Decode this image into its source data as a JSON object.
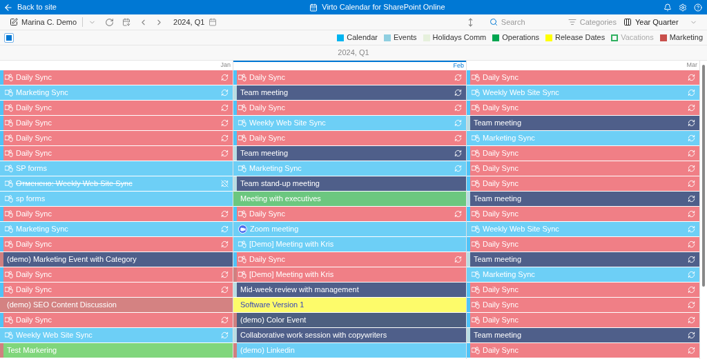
{
  "app_bar": {
    "back_label": "Back to site",
    "title": "Virto Calendar for SharePoint Online"
  },
  "toolbar": {
    "user": "Marina C. Demo",
    "period": "2024, Q1",
    "search": {
      "placeholder": "Search"
    },
    "categories": "Categories",
    "view": "Year Quarter"
  },
  "select_all": {
    "checked": true
  },
  "legend": [
    {
      "label": "Calendar",
      "color": "#00b4f0",
      "checked": true
    },
    {
      "label": "Events",
      "color": "#8fcfe0",
      "checked": true
    },
    {
      "label": "Holidays Comm",
      "color": "#e6f0dc",
      "checked": true
    },
    {
      "label": "Operations",
      "color": "#00a650",
      "checked": true
    },
    {
      "label": "Release Dates",
      "color": "#ffff00",
      "checked": true
    },
    {
      "label": "Vacations",
      "color": "#30b060",
      "checked": false
    },
    {
      "label": "Marketing",
      "color": "#c9504c",
      "checked": true
    }
  ],
  "period_title": "2024, Q1",
  "months": [
    {
      "label": "Jan",
      "current": false,
      "events": [
        {
          "title": "Daily Sync",
          "kind": "teams",
          "recurring": true,
          "canceled": false,
          "color": "#f07f86",
          "category": {
            "color": "#4fc3f7"
          }
        },
        {
          "title": "Marketing Sync",
          "kind": "teams",
          "recurring": true,
          "canceled": false,
          "color": "#6dcff6",
          "category": {
            "color": "#6dcff6"
          }
        },
        {
          "title": "Daily Sync",
          "kind": "teams",
          "recurring": true,
          "canceled": false,
          "color": "#f07f86",
          "category": {
            "color": "#4fc3f7"
          }
        },
        {
          "title": "Daily Sync",
          "kind": "teams",
          "recurring": true,
          "canceled": false,
          "color": "#f07f86",
          "category": {
            "color": "#4fc3f7"
          }
        },
        {
          "title": "Daily Sync",
          "kind": "teams",
          "recurring": true,
          "canceled": false,
          "color": "#f07f86",
          "category": {
            "color": "#4fc3f7"
          }
        },
        {
          "title": "Daily Sync",
          "kind": "teams",
          "recurring": true,
          "canceled": false,
          "color": "#f07f86",
          "category": {
            "color": "#4fc3f7"
          }
        },
        {
          "title": "SP forms",
          "kind": "teams",
          "recurring": false,
          "canceled": false,
          "color": "#6dcff6",
          "category": {
            "color": "#6dcff6"
          }
        },
        {
          "title": "Отменено: Weekly Web Site Sync",
          "kind": "teams",
          "recurring": true,
          "canceled": true,
          "color": "#6dcff6",
          "category": {
            "color": "#6dcff6"
          }
        },
        {
          "title": "sp forms",
          "kind": "teams",
          "recurring": false,
          "canceled": false,
          "color": "#6dcff6",
          "category": {
            "color": "#6dcff6"
          }
        },
        {
          "title": "Daily Sync",
          "kind": "teams",
          "recurring": true,
          "canceled": false,
          "color": "#f07f86",
          "category": {
            "color": "#4fc3f7"
          }
        },
        {
          "title": "Marketing Sync",
          "kind": "teams",
          "recurring": true,
          "canceled": false,
          "color": "#6dcff6",
          "category": {
            "color": "#6dcff6"
          }
        },
        {
          "title": "Daily Sync",
          "kind": "teams",
          "recurring": true,
          "canceled": false,
          "color": "#f07f86",
          "category": {
            "color": "#4fc3f7"
          }
        },
        {
          "title": "(demo) Marketing Event with Category",
          "kind": "plain",
          "recurring": false,
          "canceled": false,
          "color": "#4f5f8a",
          "category": {
            "color": "#d08080"
          }
        },
        {
          "title": "Daily Sync",
          "kind": "teams",
          "recurring": true,
          "canceled": false,
          "color": "#f07f86",
          "category": {
            "color": "#4fc3f7"
          }
        },
        {
          "title": "Daily Sync",
          "kind": "teams",
          "recurring": true,
          "canceled": false,
          "color": "#f07f86",
          "category": {
            "color": "#4fc3f7"
          }
        },
        {
          "title": "(demo) SEO Content Discussion",
          "kind": "plain",
          "recurring": false,
          "canceled": false,
          "color": "#d48282",
          "category": {
            "color": "#d48282"
          }
        },
        {
          "title": "Daily Sync",
          "kind": "teams",
          "recurring": true,
          "canceled": false,
          "color": "#f07f86",
          "category": {
            "color": "#4fc3f7"
          }
        },
        {
          "title": "Weekly Web Site Sync",
          "kind": "teams",
          "recurring": true,
          "canceled": false,
          "color": "#6dcff6",
          "category": {
            "color": "#6dcff6"
          }
        },
        {
          "title": "Test Markering",
          "kind": "plain",
          "recurring": false,
          "canceled": false,
          "color": "#80d67c",
          "category": {
            "color": "#d08080"
          }
        }
      ]
    },
    {
      "label": "Feb",
      "current": true,
      "events": [
        {
          "title": "Daily Sync",
          "kind": "teams",
          "recurring": true,
          "canceled": false,
          "color": "#f07f86",
          "category": {
            "color": "#4fc3f7"
          }
        },
        {
          "title": "Team meeting",
          "kind": "plain",
          "recurring": true,
          "canceled": false,
          "color": "#4f5f8a",
          "category": {
            "color": "#b9dde3"
          }
        },
        {
          "title": "Daily Sync",
          "kind": "teams",
          "recurring": true,
          "canceled": false,
          "color": "#f07f86",
          "category": {
            "color": "#4fc3f7"
          }
        },
        {
          "title": "Weekly Web Site Sync",
          "kind": "teams",
          "recurring": true,
          "canceled": false,
          "color": "#6dcff6",
          "category": {
            "color": "#6dcff6"
          }
        },
        {
          "title": "Daily Sync",
          "kind": "teams",
          "recurring": true,
          "canceled": false,
          "color": "#f07f86",
          "category": {
            "color": "#4fc3f7"
          }
        },
        {
          "title": "Team meeting",
          "kind": "plain",
          "recurring": true,
          "canceled": false,
          "color": "#4f5f8a",
          "category": {
            "color": "#b9dde3"
          }
        },
        {
          "title": "Marketing Sync",
          "kind": "teams",
          "recurring": true,
          "canceled": false,
          "color": "#6dcff6",
          "category": {
            "color": "#6dcff6"
          }
        },
        {
          "title": "Team stand-up meeting",
          "kind": "plain",
          "recurring": false,
          "canceled": false,
          "color": "#4f5f8a",
          "category": {
            "color": "#b9dde3"
          }
        },
        {
          "title": "Meeting with executives",
          "kind": "plain",
          "recurring": false,
          "canceled": false,
          "color": "#6cc77f",
          "category": {
            "color": "#6cc77f"
          }
        },
        {
          "title": "Daily Sync",
          "kind": "teams",
          "recurring": true,
          "canceled": false,
          "color": "#f07f86",
          "category": {
            "color": "#4fc3f7"
          }
        },
        {
          "title": "Zoom meeting",
          "kind": "zoom",
          "recurring": false,
          "canceled": false,
          "color": "#6dcff6",
          "category": {
            "color": "#6dcff6"
          }
        },
        {
          "title": "[Demo] Meeting with Kris",
          "kind": "teams",
          "recurring": false,
          "canceled": false,
          "color": "#6dcff6",
          "category": {
            "color": "#6dcff6"
          }
        },
        {
          "title": "Daily Sync",
          "kind": "teams",
          "recurring": true,
          "canceled": false,
          "color": "#f07f86",
          "category": {
            "color": "#4fc3f7"
          }
        },
        {
          "title": "[Demo] Meeting with Kris",
          "kind": "teams",
          "recurring": false,
          "canceled": false,
          "color": "#f07f86",
          "category": {
            "color": "#d08080"
          }
        },
        {
          "title": "Mid-week review with management",
          "kind": "plain",
          "recurring": false,
          "canceled": false,
          "color": "#4f5f8a",
          "category": {
            "color": "#b9dde3"
          }
        },
        {
          "title": "Software Version 1",
          "kind": "plain",
          "recurring": false,
          "canceled": false,
          "color": "#fdfb6a",
          "category": {
            "color": "#fdfb6a"
          }
        },
        {
          "title": "(demo) Color Event",
          "kind": "plain",
          "recurring": false,
          "canceled": false,
          "color": "#4d5f80",
          "category": {
            "color": "#d08080"
          }
        },
        {
          "title": "Collaborative work session with copywriters",
          "kind": "plain",
          "recurring": false,
          "canceled": false,
          "color": "#4f5f8a",
          "category": {
            "color": "#b9dde3"
          }
        },
        {
          "title": "(demo) Linkedin",
          "kind": "plain",
          "recurring": false,
          "canceled": false,
          "color": "#6dcff6",
          "category": {
            "color": "#d08080"
          }
        }
      ]
    },
    {
      "label": "Mar",
      "current": false,
      "events": [
        {
          "title": "Daily Sync",
          "kind": "teams",
          "recurring": true,
          "canceled": false,
          "color": "#f07f86",
          "category": {
            "color": "#4fc3f7"
          }
        },
        {
          "title": "Weekly Web Site Sync",
          "kind": "teams",
          "recurring": true,
          "canceled": false,
          "color": "#6dcff6",
          "category": {
            "color": "#6dcff6"
          }
        },
        {
          "title": "Daily Sync",
          "kind": "teams",
          "recurring": true,
          "canceled": false,
          "color": "#f07f86",
          "category": {
            "color": "#4fc3f7"
          }
        },
        {
          "title": "Team meeting",
          "kind": "plain",
          "recurring": true,
          "canceled": false,
          "color": "#4f5f8a",
          "category": {
            "color": "#b9dde3"
          }
        },
        {
          "title": "Marketing Sync",
          "kind": "teams",
          "recurring": true,
          "canceled": false,
          "color": "#6dcff6",
          "category": {
            "color": "#6dcff6"
          }
        },
        {
          "title": "Daily Sync",
          "kind": "teams",
          "recurring": true,
          "canceled": false,
          "color": "#f07f86",
          "category": {
            "color": "#4fc3f7"
          }
        },
        {
          "title": "Daily Sync",
          "kind": "teams",
          "recurring": true,
          "canceled": false,
          "color": "#f07f86",
          "category": {
            "color": "#4fc3f7"
          }
        },
        {
          "title": "Daily Sync",
          "kind": "teams",
          "recurring": true,
          "canceled": false,
          "color": "#f07f86",
          "category": {
            "color": "#4fc3f7"
          }
        },
        {
          "title": "Team meeting",
          "kind": "plain",
          "recurring": true,
          "canceled": false,
          "color": "#4f5f8a",
          "category": {
            "color": "#b9dde3"
          }
        },
        {
          "title": "Daily Sync",
          "kind": "teams",
          "recurring": true,
          "canceled": false,
          "color": "#f07f86",
          "category": {
            "color": "#4fc3f7"
          }
        },
        {
          "title": "Weekly Web Site Sync",
          "kind": "teams",
          "recurring": true,
          "canceled": false,
          "color": "#6dcff6",
          "category": {
            "color": "#6dcff6"
          }
        },
        {
          "title": "Daily Sync",
          "kind": "teams",
          "recurring": true,
          "canceled": false,
          "color": "#f07f86",
          "category": {
            "color": "#4fc3f7"
          }
        },
        {
          "title": "Team meeting",
          "kind": "plain",
          "recurring": true,
          "canceled": false,
          "color": "#4f5f8a",
          "category": {
            "color": "#b9dde3"
          }
        },
        {
          "title": "Marketing Sync",
          "kind": "teams",
          "recurring": true,
          "canceled": false,
          "color": "#6dcff6",
          "category": {
            "color": "#6dcff6"
          }
        },
        {
          "title": "Daily Sync",
          "kind": "teams",
          "recurring": true,
          "canceled": false,
          "color": "#f07f86",
          "category": {
            "color": "#4fc3f7"
          }
        },
        {
          "title": "Daily Sync",
          "kind": "teams",
          "recurring": true,
          "canceled": false,
          "color": "#f07f86",
          "category": {
            "color": "#4fc3f7"
          }
        },
        {
          "title": "Daily Sync",
          "kind": "teams",
          "recurring": true,
          "canceled": false,
          "color": "#f07f86",
          "category": {
            "color": "#4fc3f7"
          }
        },
        {
          "title": "Team meeting",
          "kind": "plain",
          "recurring": true,
          "canceled": false,
          "color": "#4f5f8a",
          "category": {
            "color": "#b9dde3"
          }
        },
        {
          "title": "Daily Sync",
          "kind": "teams",
          "recurring": true,
          "canceled": false,
          "color": "#f07f86",
          "category": {
            "color": "#4fc3f7"
          }
        }
      ]
    }
  ]
}
